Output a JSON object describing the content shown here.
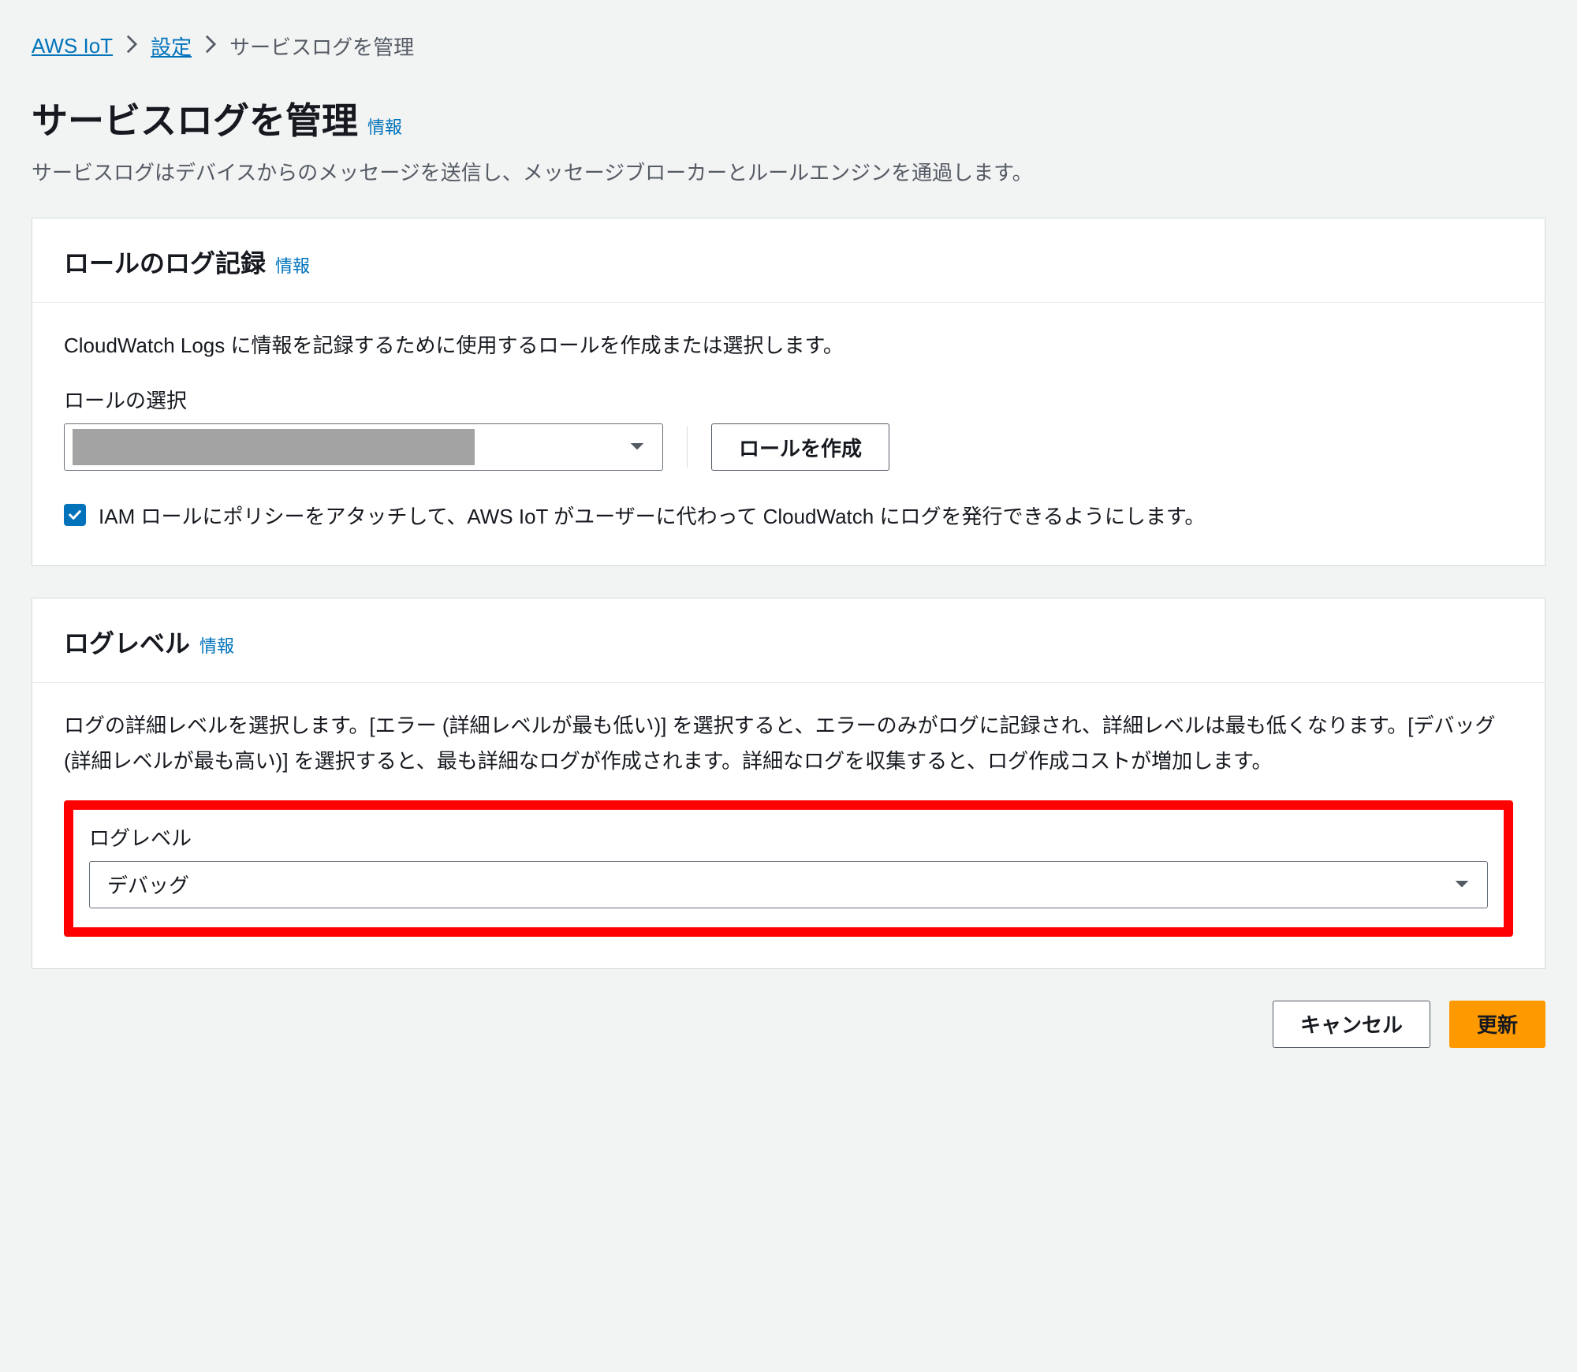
{
  "breadcrumb": {
    "root": "AWS IoT",
    "settings": "設定",
    "current": "サービスログを管理"
  },
  "page": {
    "title": "サービスログを管理",
    "info": "情報",
    "description": "サービスログはデバイスからのメッセージを送信し、メッセージブローカーとルールエンジンを通過します。"
  },
  "roleSection": {
    "title": "ロールのログ記録",
    "info": "情報",
    "description": "CloudWatch Logs に情報を記録するために使用するロールを作成または選択します。",
    "fieldLabel": "ロールの選択",
    "createRole": "ロールを作成",
    "checkboxLabel": "IAM ロールにポリシーをアタッチして、AWS IoT がユーザーに代わって CloudWatch にログを発行できるようにします。"
  },
  "logLevelSection": {
    "title": "ログレベル",
    "info": "情報",
    "description": "ログの詳細レベルを選択します。[エラー (詳細レベルが最も低い)] を選択すると、エラーのみがログに記録され、詳細レベルは最も低くなります。[デバッグ (詳細レベルが最も高い)] を選択すると、最も詳細なログが作成されます。詳細なログを収集すると、ログ作成コストが増加します。",
    "fieldLabel": "ログレベル",
    "selected": "デバッグ"
  },
  "footer": {
    "cancel": "キャンセル",
    "update": "更新"
  }
}
